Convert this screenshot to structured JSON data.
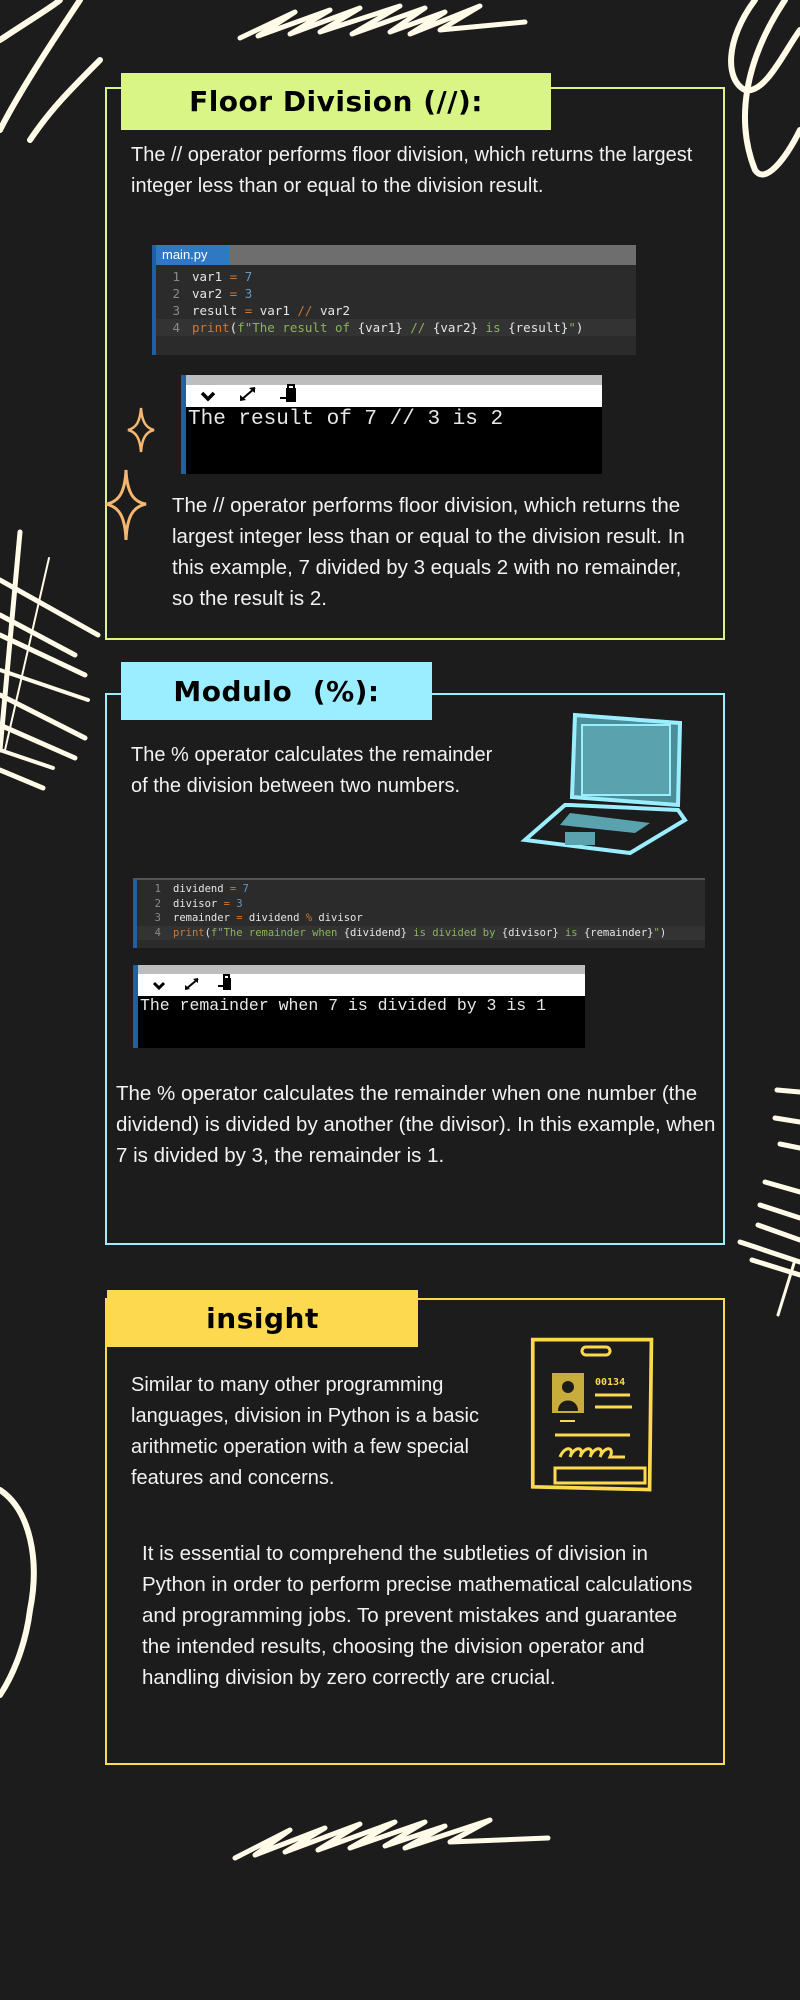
{
  "colors": {
    "background": "#1c1c1c",
    "floor_accent": "#d8f585",
    "modulo_accent": "#9beeff",
    "insight_accent": "#fcd94e",
    "scribble": "#fffbe8",
    "sparkle": "#f6b66f"
  },
  "floor": {
    "heading": "Floor Division (//):",
    "intro": "The // operator performs floor division, which returns the largest integer less than or equal to the division result.",
    "editor": {
      "tab": "main.py",
      "lines": [
        {
          "n": "1",
          "parts": [
            [
              "w",
              "var1 "
            ],
            [
              "k",
              "="
            ],
            [
              "n",
              " 7"
            ]
          ]
        },
        {
          "n": "2",
          "parts": [
            [
              "w",
              "var2 "
            ],
            [
              "k",
              "="
            ],
            [
              "n",
              " 3"
            ]
          ]
        },
        {
          "n": "3",
          "parts": [
            [
              "w",
              "result "
            ],
            [
              "k",
              "="
            ],
            [
              "w",
              " var1 "
            ],
            [
              "k",
              "//"
            ],
            [
              "w",
              " var2"
            ]
          ]
        },
        {
          "n": "4",
          "parts": [
            [
              "k",
              "print"
            ],
            [
              "w",
              "("
            ],
            [
              "s",
              "f\"The result of "
            ],
            [
              "w",
              "{var1}"
            ],
            [
              "s",
              " // "
            ],
            [
              "w",
              "{var2}"
            ],
            [
              "s",
              " is "
            ],
            [
              "w",
              "{result}"
            ],
            [
              "s",
              "\""
            ],
            [
              "w",
              ")"
            ]
          ]
        }
      ]
    },
    "output": "The result of 7 // 3 is 2",
    "explanation": "The // operator performs floor division, which returns the largest integer less than or equal to the division result. In this example, 7 divided by 3 equals 2 with no remainder, so the result is 2."
  },
  "modulo": {
    "heading": "Modulo  (%):",
    "intro": "The % operator calculates the remainder of the division between two numbers.",
    "editor": {
      "lines": [
        {
          "n": "1",
          "parts": [
            [
              "w",
              "dividend "
            ],
            [
              "k",
              "="
            ],
            [
              "n",
              " 7"
            ]
          ]
        },
        {
          "n": "2",
          "parts": [
            [
              "w",
              "divisor "
            ],
            [
              "k",
              "="
            ],
            [
              "n",
              " 3"
            ]
          ]
        },
        {
          "n": "3",
          "parts": [
            [
              "w",
              "remainder "
            ],
            [
              "k",
              "="
            ],
            [
              "w",
              " dividend "
            ],
            [
              "k",
              "%"
            ],
            [
              "w",
              " divisor"
            ]
          ]
        },
        {
          "n": "4",
          "parts": [
            [
              "k",
              "print"
            ],
            [
              "w",
              "("
            ],
            [
              "s",
              "f\"The remainder when "
            ],
            [
              "w",
              "{dividend}"
            ],
            [
              "s",
              " is divided by "
            ],
            [
              "w",
              "{divisor}"
            ],
            [
              "s",
              " is "
            ],
            [
              "w",
              "{remainder}"
            ],
            [
              "s",
              "\""
            ],
            [
              "w",
              ")"
            ]
          ]
        }
      ]
    },
    "output": "The remainder when 7 is divided by 3 is 1",
    "explanation": "The % operator calculates the remainder when one number (the dividend) is divided by another (the divisor). In this example, when 7 is divided by 3, the remainder is 1."
  },
  "insight": {
    "heading": "insight",
    "intro": "Similar to many other programming languages, division in Python is a basic arithmetic operation with a few special features and concerns.",
    "id_number": "00134",
    "explanation": "It is essential to comprehend the subtleties of division in Python in order to perform precise mathematical calculations and programming jobs. To prevent mistakes and guarantee the intended results, choosing the division operator and handling division by zero correctly are crucial."
  },
  "icons": {
    "collapse": "chevron-down-icon",
    "expand": "expand-arrows-icon",
    "clipboard": "clipboard-icon",
    "laptop": "laptop-illustration",
    "id_card": "id-card-illustration",
    "sparkle": "sparkle-icon"
  }
}
